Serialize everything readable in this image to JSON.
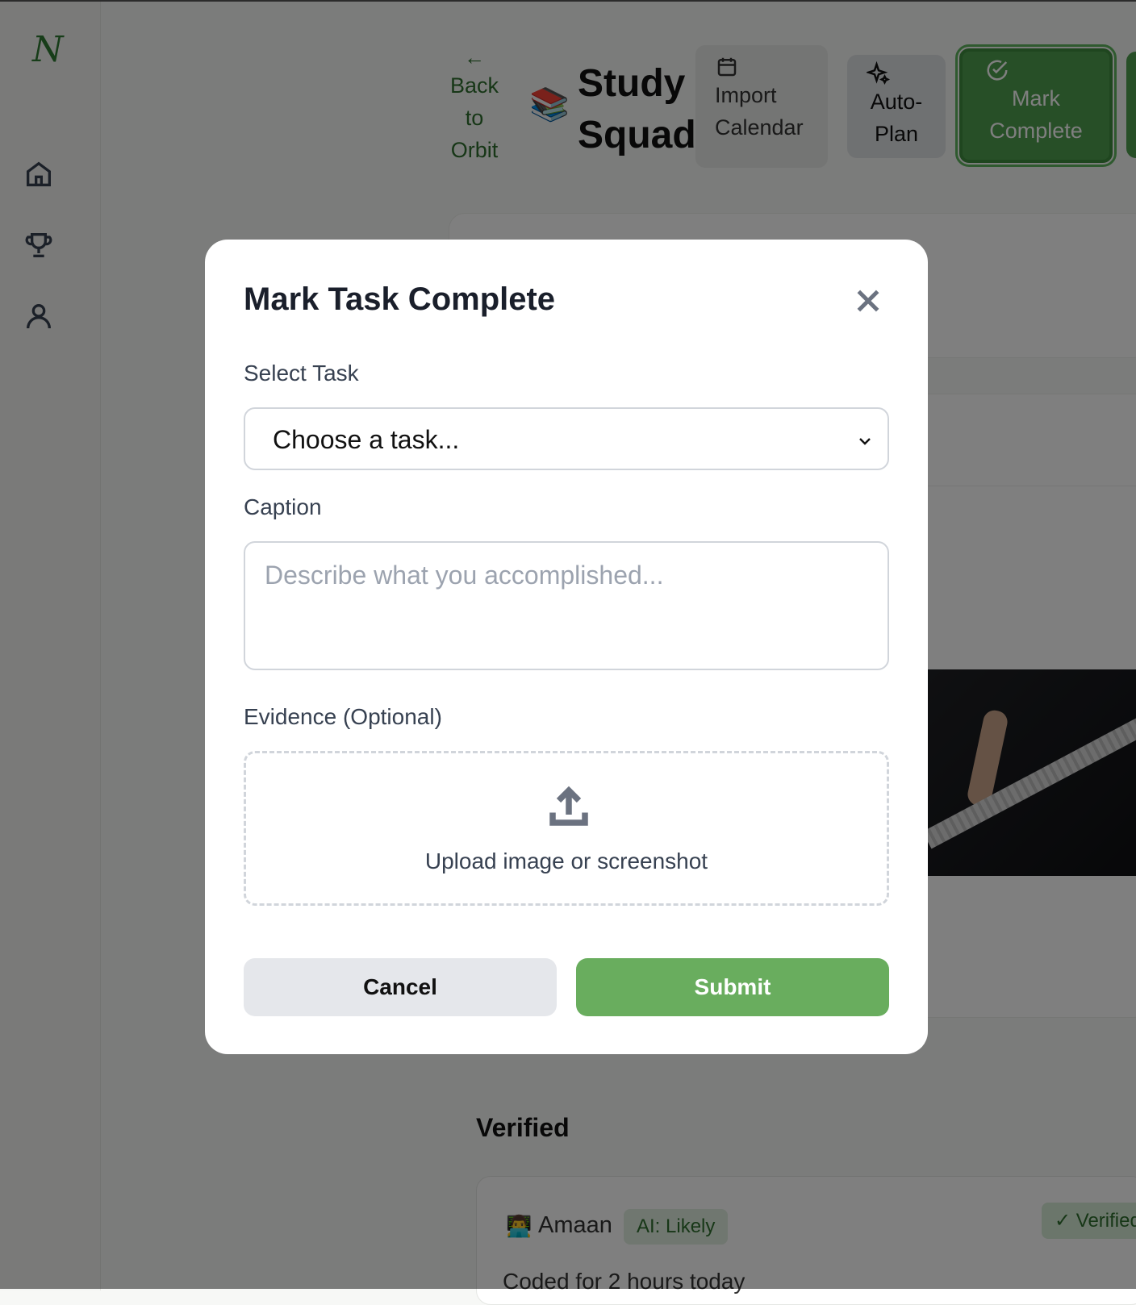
{
  "sidebar": {
    "logo": "N",
    "items": [
      {
        "name": "home-icon"
      },
      {
        "name": "trophy-icon"
      },
      {
        "name": "user-icon"
      }
    ]
  },
  "header": {
    "back_arrow": "←",
    "back_label": "Back to Orbit",
    "squad_emoji": "📚",
    "squad_title": "Study Squad",
    "import_label": "Import Calendar",
    "autoplan_label": "Auto-Plan",
    "mark_label": "Mark Complete"
  },
  "feed": {
    "verified_title": "Verified",
    "post": {
      "emoji": "👨‍💻",
      "user": "Amaan",
      "ai_badge": "AI: Likely",
      "verified_badge": "✓ Verified",
      "caption": "Coded for 2 hours today"
    }
  },
  "modal": {
    "title": "Mark Task Complete",
    "select_label": "Select Task",
    "select_value": "Choose a task...",
    "caption_label": "Caption",
    "caption_placeholder": "Describe what you accomplished...",
    "evidence_label": "Evidence (Optional)",
    "upload_label": "Upload image or screenshot",
    "cancel_label": "Cancel",
    "submit_label": "Submit"
  },
  "colors": {
    "accent": "#69ad5e",
    "brand_dark": "#2f6f2f"
  }
}
